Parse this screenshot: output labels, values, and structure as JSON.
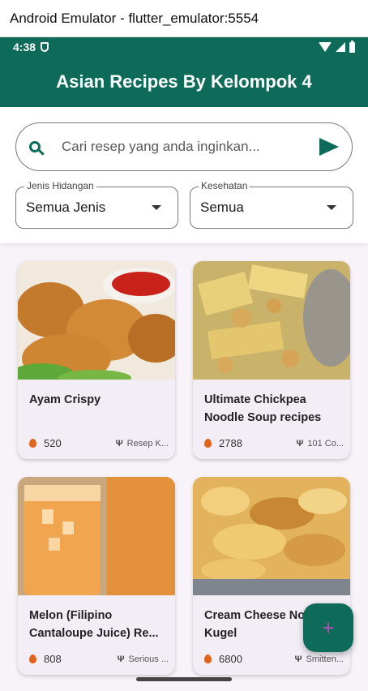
{
  "window": {
    "title": "Android Emulator - flutter_emulator:5554"
  },
  "status_bar": {
    "time": "4:38"
  },
  "app_bar": {
    "title": "Asian Recipes By Kelompok 4"
  },
  "search": {
    "placeholder": "Cari resep yang anda inginkan..."
  },
  "filters": [
    {
      "label": "Jenis Hidangan",
      "value": "Semua Jenis"
    },
    {
      "label": "Kesehatan",
      "value": "Semua"
    }
  ],
  "recipes": [
    {
      "title": "Ayam Crispy",
      "calories": "520",
      "source": "Resep K..."
    },
    {
      "title": "Ultimate Chickpea Noodle Soup recipes",
      "calories": "2788",
      "source": "101 Co..."
    },
    {
      "title": "Melon (Filipino Cantaloupe Juice) Re...",
      "calories": "808",
      "source": "Serious ..."
    },
    {
      "title": "Cream Cheese Noodle Kugel",
      "calories": "6800",
      "source": "Smitten..."
    }
  ],
  "fab": {
    "label": "+"
  },
  "colors": {
    "primary": "#0e6b5a",
    "card_bg": "#f3eef6",
    "flame": "#e0641b"
  }
}
